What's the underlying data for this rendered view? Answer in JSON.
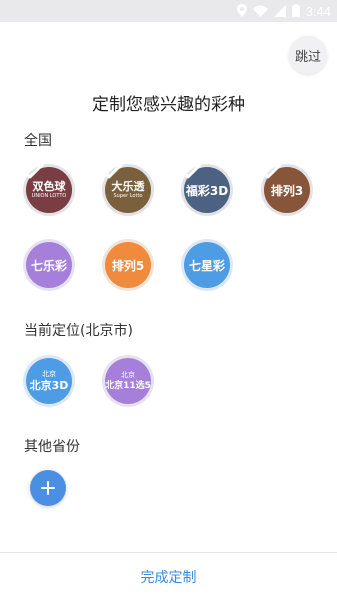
{
  "status_bar": {
    "time": "3:44",
    "icons": [
      "location-icon",
      "wifi-icon",
      "signal-icon",
      "battery-icon"
    ]
  },
  "skip_label": "跳过",
  "title": "定制您感兴趣的彩种",
  "sections": {
    "national": "全国",
    "current_location": "当前定位(北京市)",
    "other_provinces": "其他省份"
  },
  "national_lotteries": [
    {
      "name": "双色球",
      "sub": "UNION LOTTO",
      "selected": true,
      "color": "#c0392b"
    },
    {
      "name": "大乐透",
      "sub": "Super Lotto",
      "selected": true,
      "color": "#c8a13a"
    },
    {
      "name": "福彩3D",
      "sub": "",
      "selected": true,
      "color": "#3d72c4"
    },
    {
      "name": "排列3",
      "sub": "",
      "selected": true,
      "color": "#e67e22"
    },
    {
      "name": "七乐彩",
      "sub": "",
      "selected": false,
      "color": "#9b6fd6"
    },
    {
      "name": "排列5",
      "sub": "",
      "selected": false,
      "color": "#f0883a"
    },
    {
      "name": "七星彩",
      "sub": "",
      "selected": false,
      "color": "#4a9be6"
    }
  ],
  "local_lotteries": [
    {
      "name": "北京3D",
      "sub": "北京",
      "selected": false,
      "color": "#4a9be6"
    },
    {
      "name": "北京11选5",
      "sub": "北京",
      "selected": false,
      "color": "#9b6fd6"
    }
  ],
  "finish_label": "完成定制"
}
